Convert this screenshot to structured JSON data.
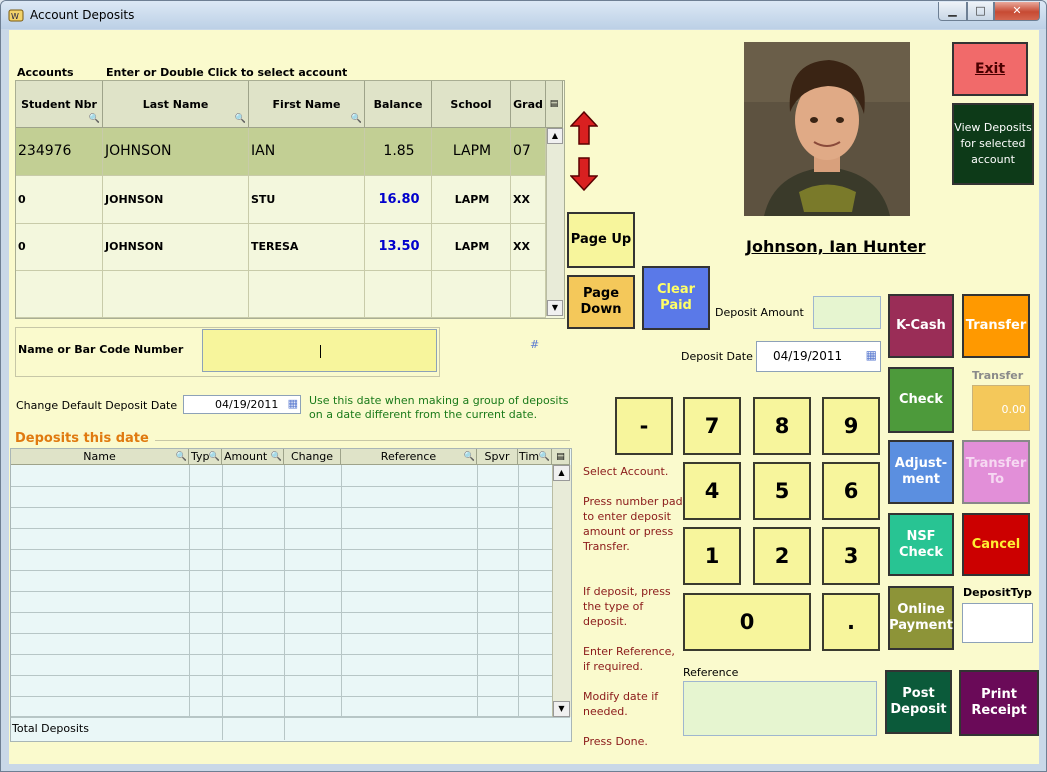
{
  "window": {
    "title": "Account Deposits",
    "min": "▁",
    "max": "□",
    "close": "✕"
  },
  "accounts": {
    "section_label": "Accounts",
    "hint": "Enter or Double Click to select account",
    "columns": [
      "Student Nbr",
      "Last Name",
      "First Name",
      "Balance",
      "School",
      "Grad"
    ],
    "rows": [
      {
        "student_nbr": "234976",
        "last_name": "JOHNSON",
        "first_name": "IAN",
        "balance": "1.85",
        "school": "LAPM",
        "grad": "07"
      },
      {
        "student_nbr": "0",
        "last_name": "JOHNSON",
        "first_name": "STU",
        "balance": "16.80",
        "school": "LAPM",
        "grad": "XX"
      },
      {
        "student_nbr": "0",
        "last_name": "JOHNSON",
        "first_name": "TERESA",
        "balance": "13.50",
        "school": "LAPM",
        "grad": "XX"
      }
    ]
  },
  "nav": {
    "page_up": "Page Up",
    "page_down": "Page Down",
    "clear_paid": "Clear Paid"
  },
  "search": {
    "label": "Name or  Bar Code Number",
    "value": "",
    "hash": "#"
  },
  "default_date": {
    "label": "Change Default Deposit Date",
    "value": "04/19/2011",
    "note": "Use this date when making a group of deposits on a date different from the current date."
  },
  "deposits": {
    "title": "Deposits this date",
    "columns": [
      "Name",
      "Typ",
      "Amount",
      "Change",
      "Reference",
      "Spvr",
      "Tim"
    ],
    "total_label": "Total Deposits"
  },
  "instructions": [
    "Select Account.",
    "Press number pad to enter deposit amount or press Transfer.",
    "If deposit, press the type of deposit.",
    "Enter Reference, if required.",
    "Modify date if needed.",
    "Press Done."
  ],
  "student": {
    "name": "Johnson, Ian Hunter"
  },
  "deposit_amount": {
    "label": "Deposit Amount",
    "value": ""
  },
  "deposit_date": {
    "label": "Deposit Date",
    "value": "04/19/2011"
  },
  "keypad": {
    "minus": "-",
    "k7": "7",
    "k8": "8",
    "k9": "9",
    "k4": "4",
    "k5": "5",
    "k6": "6",
    "k1": "1",
    "k2": "2",
    "k3": "3",
    "k0": "0",
    "dot": "."
  },
  "reference": {
    "label": "Reference",
    "value": ""
  },
  "buttons": {
    "exit": "Exit",
    "view_deposits": "View Deposits for selected account",
    "kcash": "K-Cash",
    "transfer": "Transfer",
    "check": "Check",
    "adjustment": "Adjust-ment",
    "transfer_to": "Transfer To",
    "nsf_check": "NSF Check",
    "cancel": "Cancel",
    "online_payment": "Online Payment",
    "post_deposit": "Post Deposit",
    "print_receipt": "Print Receipt"
  },
  "transfer_field": {
    "label": "Transfer",
    "value": "0.00"
  },
  "deposit_type": {
    "label": "DepositTyp",
    "value": ""
  },
  "colors": {
    "background": "#fafacd",
    "selected_row": "#c2cf94",
    "balance_blue": "#0000cc",
    "exit": "#f16a6a",
    "view": "#0d3a18",
    "kcash": "#9a2d57",
    "transfer": "#ff9900",
    "check": "#4d9a3b",
    "adjustment": "#5b8fe0",
    "transfer_to": "#e28fd8",
    "nsf": "#28c493",
    "cancel": "#cc0000",
    "online": "#8d9438",
    "post": "#0b5a3a",
    "print": "#6a0a58",
    "clear_paid": "#5a79e8",
    "page_btn": "#f7f59c",
    "page_down": "#f4c85a"
  }
}
